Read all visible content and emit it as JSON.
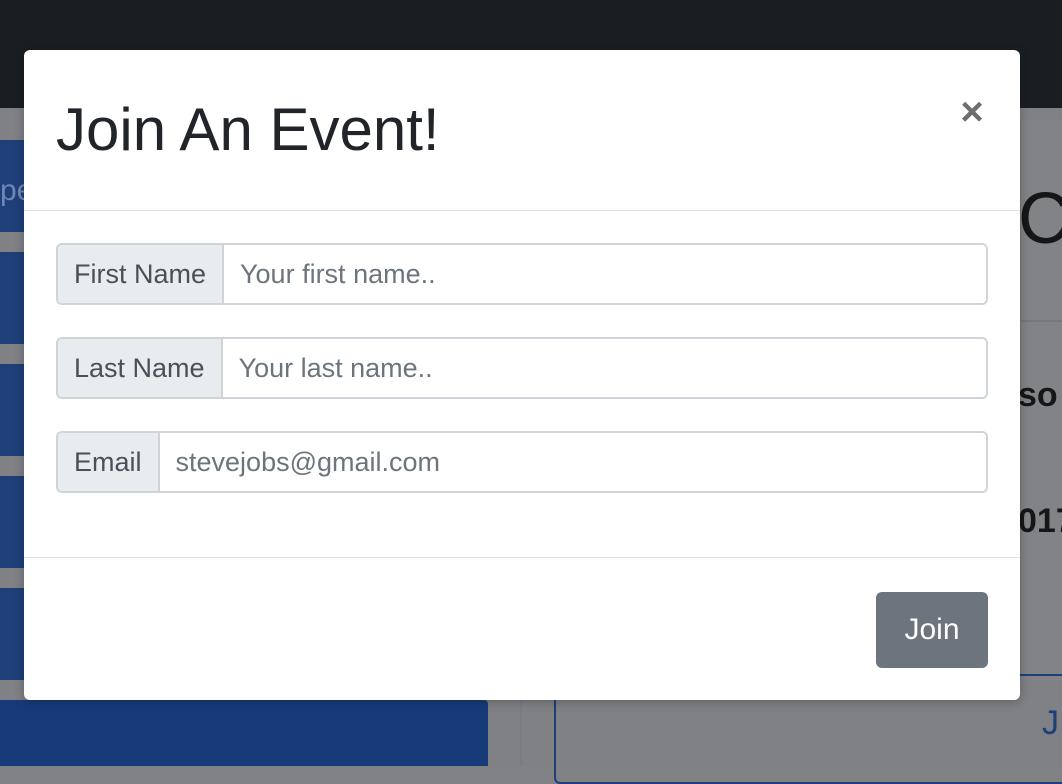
{
  "modal": {
    "title": "Join An Event!",
    "close_label": "×",
    "fields": {
      "first_name": {
        "label": "First Name",
        "placeholder": "Your first name.."
      },
      "last_name": {
        "label": "Last Name",
        "placeholder": "Your last name.."
      },
      "email": {
        "label": "Email",
        "placeholder": "stevejobs@gmail.com"
      }
    },
    "submit_label": "Join"
  },
  "background": {
    "left_fragment": "pe",
    "right_heading_fragment": "C",
    "right_text_fragment_1": "so",
    "right_text_fragment_2": "017",
    "outline_button_fragment": "J"
  },
  "colors": {
    "overlay": "#808285",
    "navbar": "#1b1e21",
    "primary_dimmed": "#1e3f7a",
    "secondary_button": "#6c757d"
  }
}
